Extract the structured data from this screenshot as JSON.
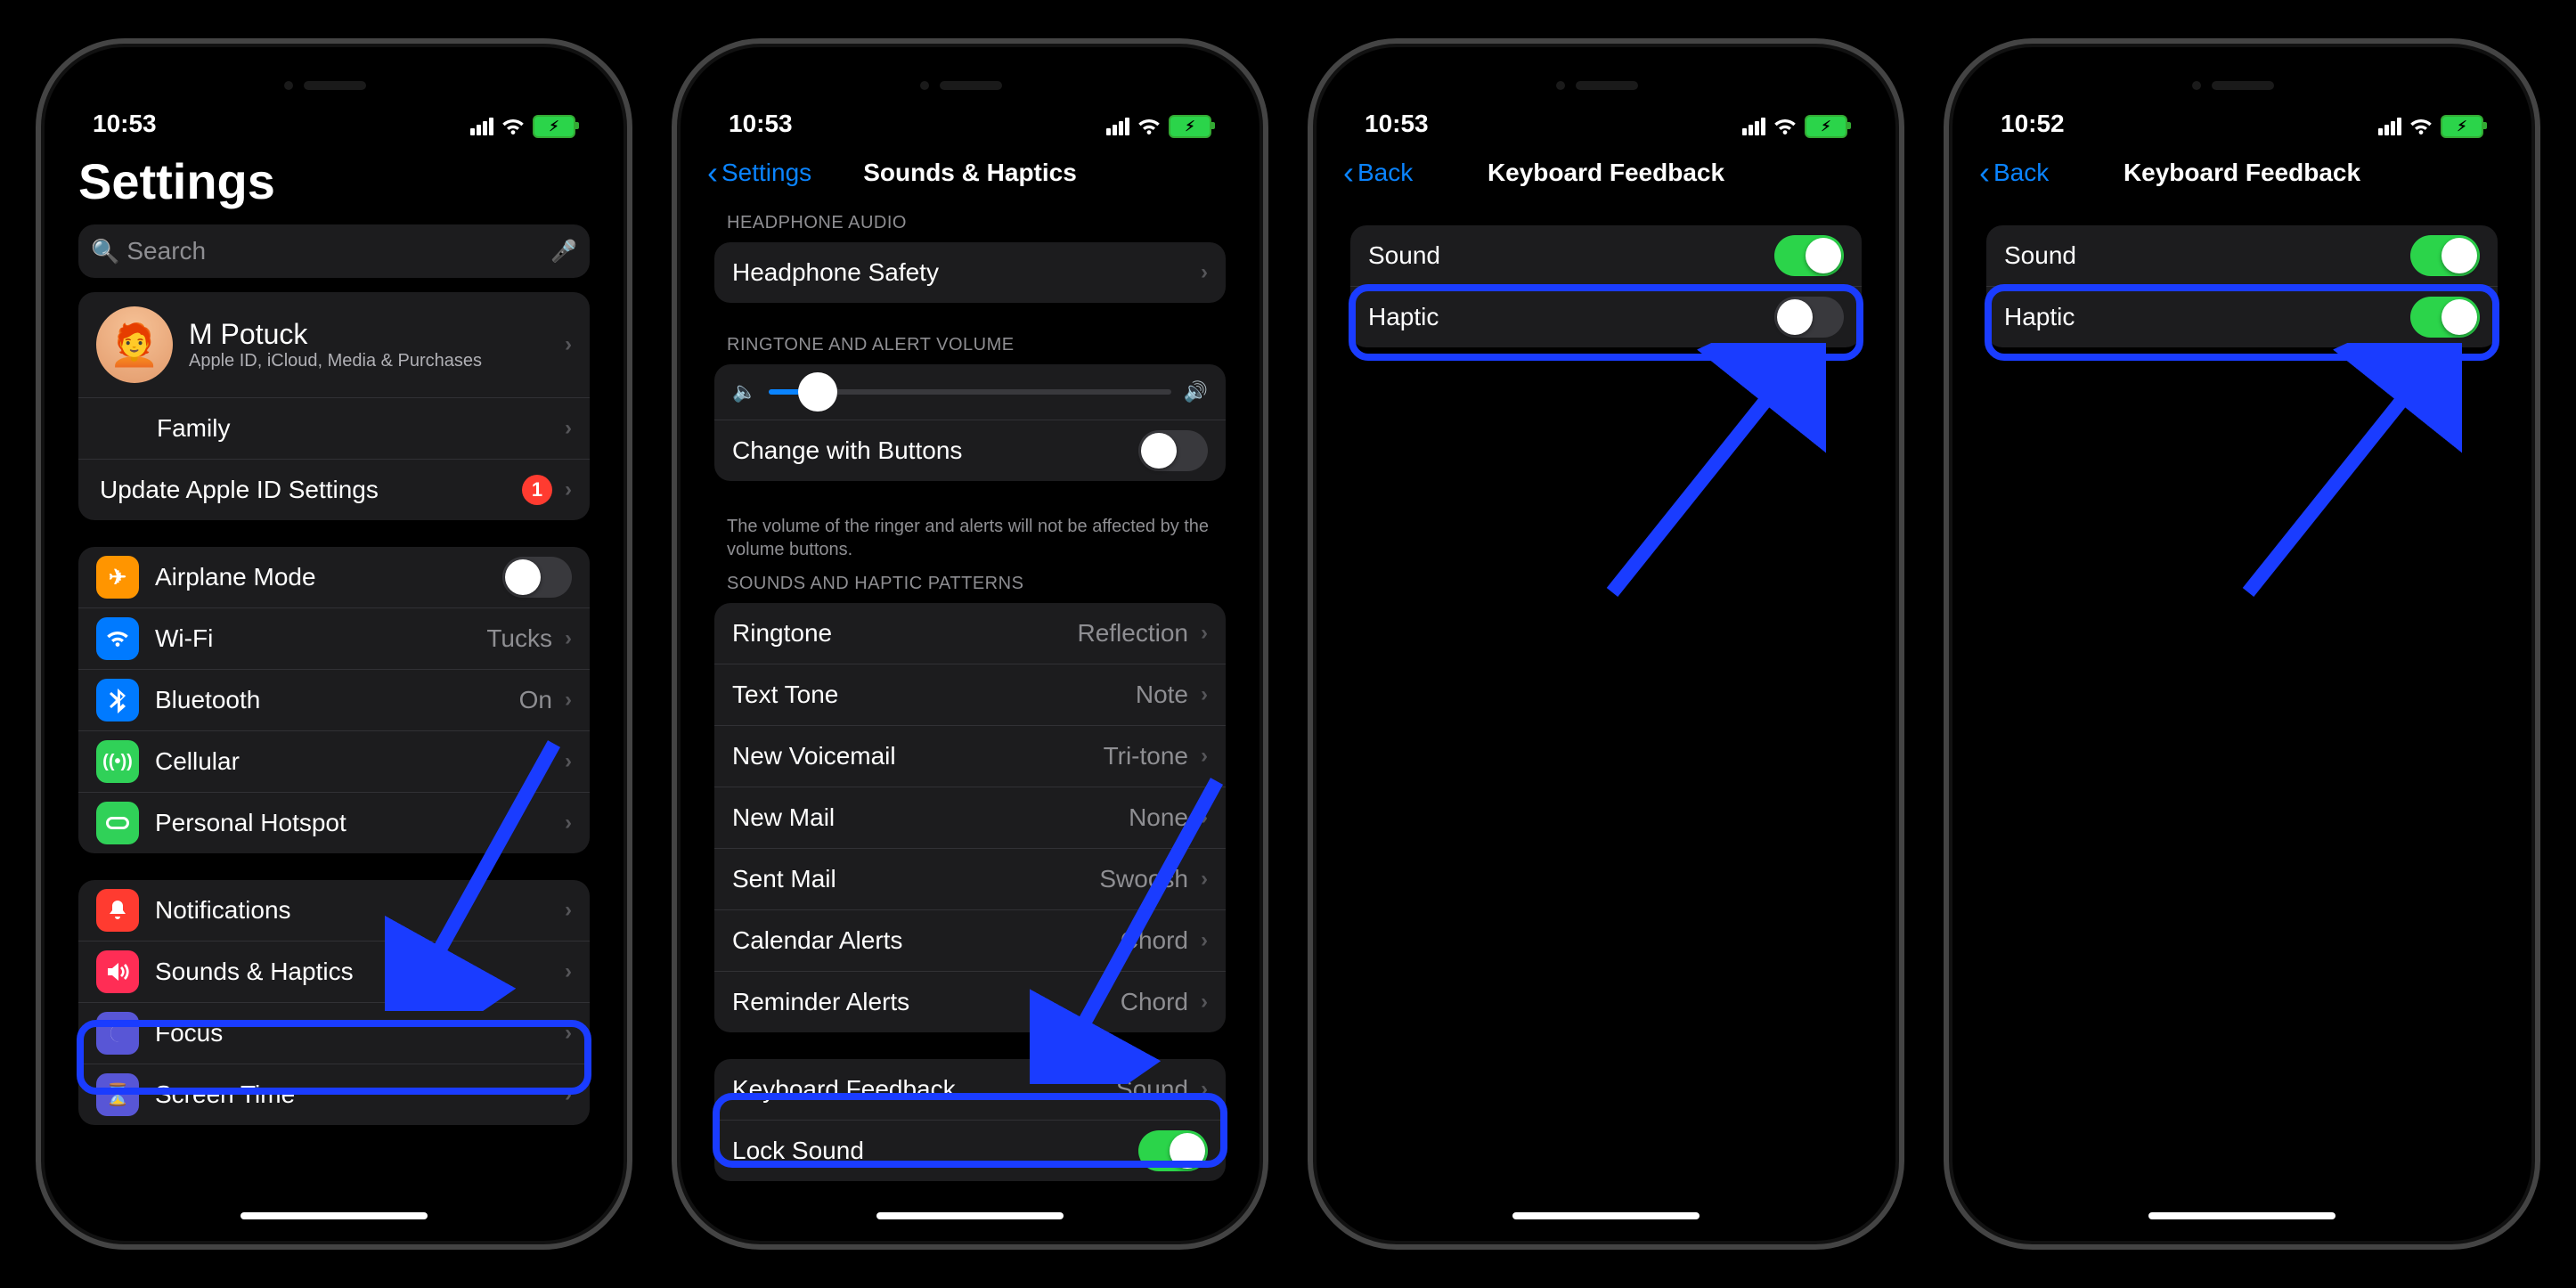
{
  "status": {
    "time_a": "10:53",
    "time_b": "10:53",
    "time_c": "10:53",
    "time_d": "10:52"
  },
  "screen1": {
    "title": "Settings",
    "search_placeholder": "Search",
    "profile_name": "M Potuck",
    "profile_sub": "Apple ID, iCloud, Media & Purchases",
    "family": "Family",
    "update": "Update Apple ID Settings",
    "update_badge": "1",
    "airplane": "Airplane Mode",
    "wifi": "Wi-Fi",
    "wifi_val": "Tucks",
    "bt": "Bluetooth",
    "bt_val": "On",
    "cell": "Cellular",
    "hotspot": "Personal Hotspot",
    "notif": "Notifications",
    "sounds": "Sounds & Haptics",
    "focus": "Focus",
    "screentime": "Screen Time"
  },
  "screen2": {
    "back": "Settings",
    "title": "Sounds & Haptics",
    "hdr_headphone": "HEADPHONE AUDIO",
    "headphone_safety": "Headphone Safety",
    "hdr_ringtone": "RINGTONE AND ALERT VOLUME",
    "change_buttons": "Change with Buttons",
    "footer_vol": "The volume of the ringer and alerts will not be affected by the volume buttons.",
    "hdr_patterns": "SOUNDS AND HAPTIC PATTERNS",
    "ringtone": "Ringtone",
    "ringtone_v": "Reflection",
    "texttone": "Text Tone",
    "texttone_v": "Note",
    "voicemail": "New Voicemail",
    "voicemail_v": "Tri-tone",
    "newmail": "New Mail",
    "newmail_v": "None",
    "sentmail": "Sent Mail",
    "sentmail_v": "Swoosh",
    "calendar": "Calendar Alerts",
    "calendar_v": "Chord",
    "reminder": "Reminder Alerts",
    "reminder_v": "Chord",
    "keyboard": "Keyboard Feedback",
    "keyboard_v": "Sound",
    "locksound": "Lock Sound"
  },
  "screen3": {
    "back": "Back",
    "title": "Keyboard Feedback",
    "sound": "Sound",
    "haptic": "Haptic",
    "haptic_on": false
  },
  "screen4": {
    "back": "Back",
    "title": "Keyboard Feedback",
    "sound": "Sound",
    "haptic": "Haptic",
    "haptic_on": true
  },
  "colors": {
    "airplane": "#ff9500",
    "wifi": "#007aff",
    "bt": "#007aff",
    "cell": "#30d158",
    "hotspot": "#30d158",
    "notif": "#ff3b30",
    "sounds": "#ff2d55",
    "focus": "#5856d6",
    "screentime": "#5856d6"
  }
}
